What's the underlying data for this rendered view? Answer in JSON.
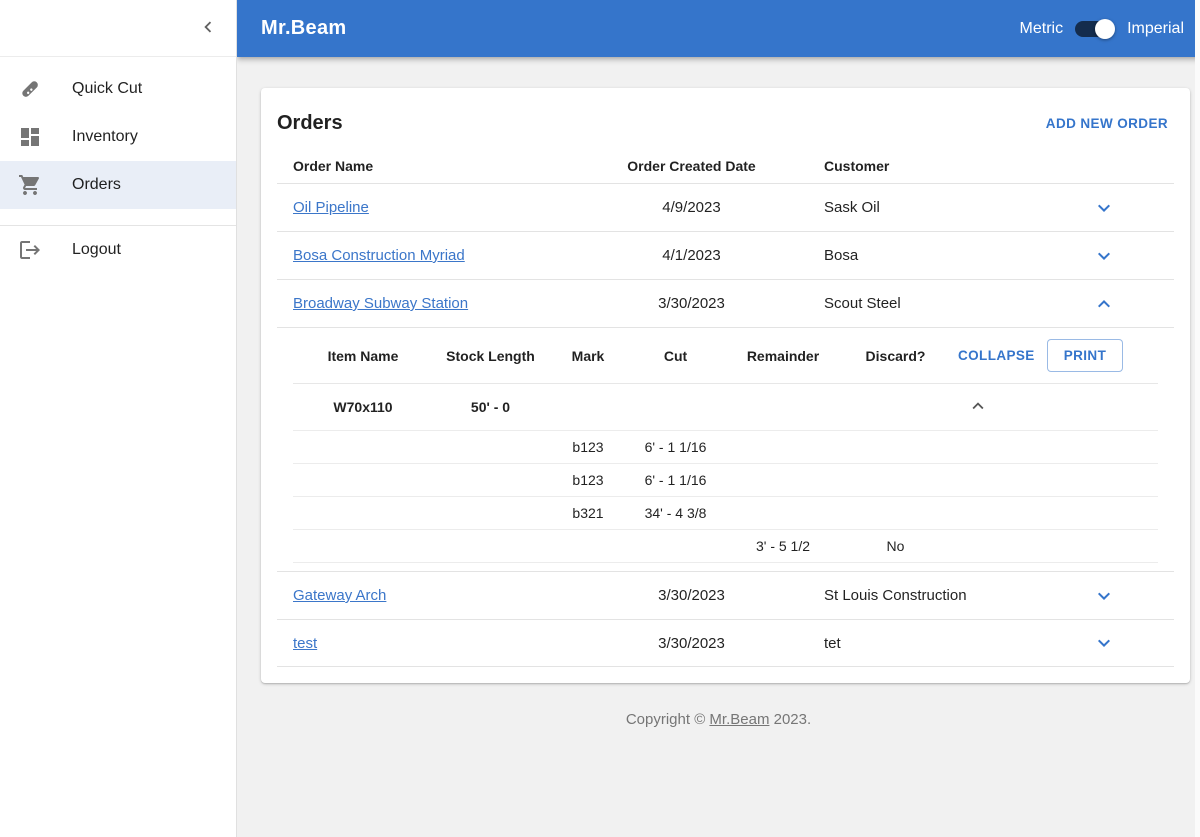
{
  "app": {
    "title": "Mr.Beam",
    "unit_toggle": {
      "left_label": "Metric",
      "right_label": "Imperial",
      "state": "imperial"
    }
  },
  "sidebar": {
    "items": [
      {
        "label": "Quick Cut",
        "icon": "saw-icon",
        "selected": false
      },
      {
        "label": "Inventory",
        "icon": "dashboard-icon",
        "selected": false
      },
      {
        "label": "Orders",
        "icon": "shopping-cart-icon",
        "selected": true
      },
      {
        "label": "Logout",
        "icon": "logout-icon",
        "selected": false
      }
    ]
  },
  "orders": {
    "title": "Orders",
    "add_label": "ADD NEW ORDER",
    "columns": [
      "Order Name",
      "Order Created Date",
      "Customer"
    ],
    "rows": [
      {
        "name": "Oil Pipeline",
        "created": "4/9/2023",
        "customer": "Sask Oil",
        "expanded": false
      },
      {
        "name": "Bosa Construction Myriad",
        "created": "4/1/2023",
        "customer": "Bosa",
        "expanded": false
      },
      {
        "name": "Broadway Subway Station",
        "created": "3/30/2023",
        "customer": "Scout Steel",
        "expanded": true
      },
      {
        "name": "Gateway Arch",
        "created": "3/30/2023",
        "customer": "St Louis Construction",
        "expanded": false
      },
      {
        "name": "test",
        "created": "3/30/2023",
        "customer": "tet",
        "expanded": false
      }
    ]
  },
  "detail": {
    "columns": [
      "Item Name",
      "Stock Length",
      "Mark",
      "Cut",
      "Remainder",
      "Discard?"
    ],
    "collapse_label": "COLLAPSE",
    "print_label": "PRINT",
    "stock": {
      "item_name": "W70x110",
      "stock_length": "50' - 0"
    },
    "cuts": [
      {
        "mark": "b123",
        "cut": "6' - 1 1/16"
      },
      {
        "mark": "b123",
        "cut": "6' - 1 1/16"
      },
      {
        "mark": "b321",
        "cut": "34' - 4 3/8"
      }
    ],
    "remainder": {
      "value": "3' - 5 1/2",
      "discard": "No"
    }
  },
  "footer": {
    "prefix": "Copyright © ",
    "brand": "Mr.Beam",
    "suffix": " 2023."
  },
  "colors": {
    "primary": "#3575cb",
    "link": "#3b76c9",
    "selected_nav_bg": "#e9eef7",
    "page_background": "#f1f1f1",
    "switch_track": "rgba(0,0,0,0.62)",
    "switch_thumb": "#ffffff"
  }
}
